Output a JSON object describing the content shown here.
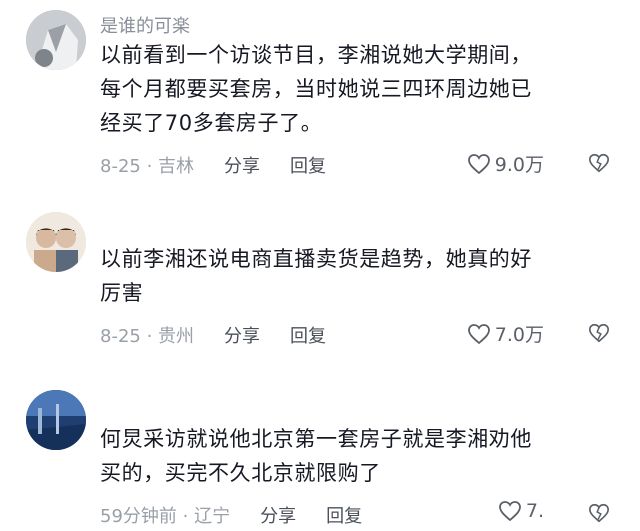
{
  "comments": [
    {
      "username": "是谁的可楽",
      "text_lines": [
        "以前看到一个访谈节目，李湘说她大学期间，",
        "每个月都要买套房，当时她说三四环周边她已",
        "经买了70多套房子了。"
      ],
      "date_location": "8-25 · 吉林",
      "share_label": "分享",
      "reply_label": "回复",
      "likes": "9.0万"
    },
    {
      "username": "",
      "text_lines": [
        "以前李湘还说电商直播卖货是趋势，她真的好",
        "厉害"
      ],
      "date_location": "8-25 · 贵州",
      "share_label": "分享",
      "reply_label": "回复",
      "likes": "7.0万"
    },
    {
      "username": "",
      "text_lines": [
        "何炅采访就说他北京第一套房子就是李湘劝他",
        "买的，买完不久北京就限购了"
      ],
      "date_location": "59分钟前 · 辽宁",
      "share_label": "分享",
      "reply_label": "回复",
      "likes": "7."
    }
  ],
  "icons": {
    "like": "heart-outline-icon",
    "dislike": "broken-heart-icon"
  },
  "colors": {
    "text": "#161823",
    "secondary": "#9aa0a8",
    "action": "#4a4f58"
  }
}
